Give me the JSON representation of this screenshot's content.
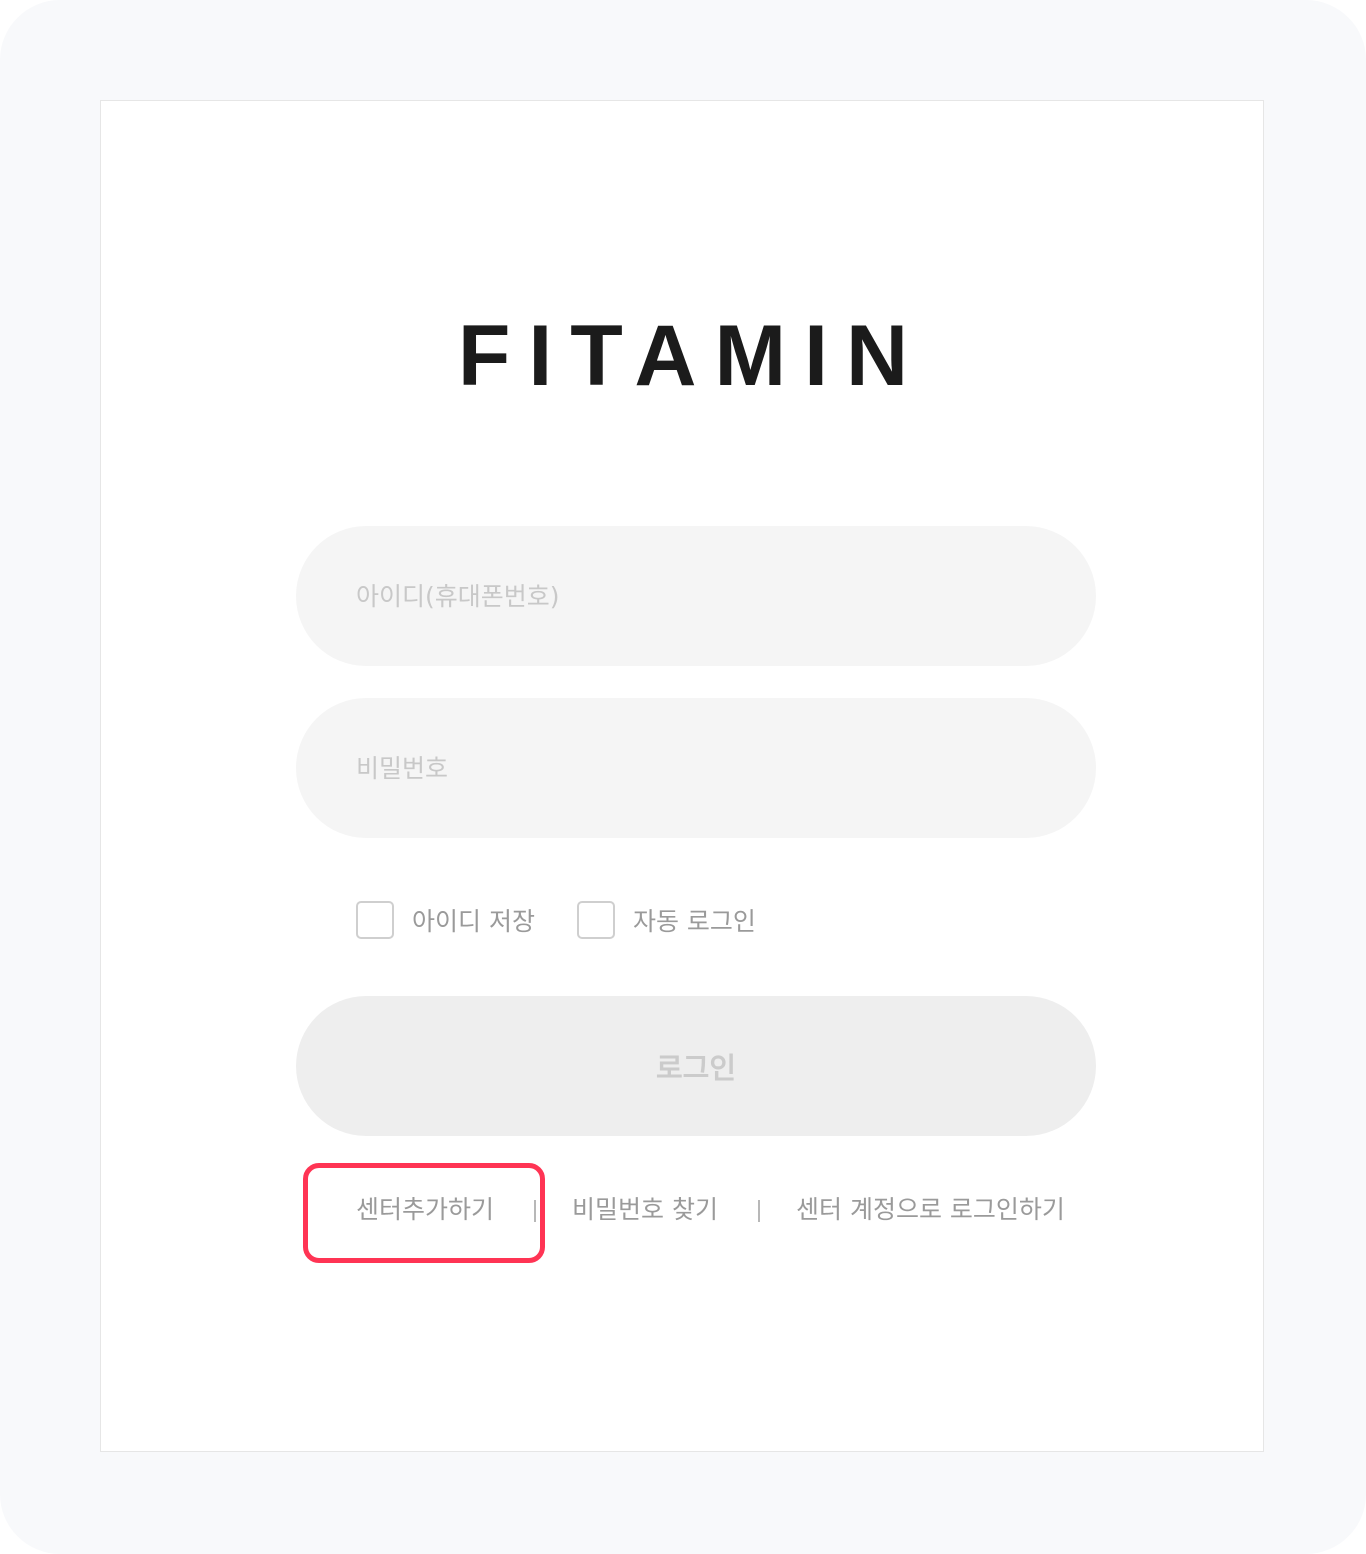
{
  "app": {
    "logo_text": "FITAMIN"
  },
  "login_form": {
    "id_placeholder": "아이디(휴대폰번호)",
    "password_placeholder": "비밀번호",
    "remember_id_label": "아이디 저장",
    "auto_login_label": "자동 로그인",
    "login_button_label": "로그인"
  },
  "footer_links": {
    "add_center": "센터추가하기",
    "find_password": "비밀번호 찾기",
    "center_account_login": "센터 계정으로 로그인하기"
  },
  "colors": {
    "highlight": "#ff3454",
    "field_background": "#f5f5f5",
    "button_background": "#eeeeee"
  }
}
